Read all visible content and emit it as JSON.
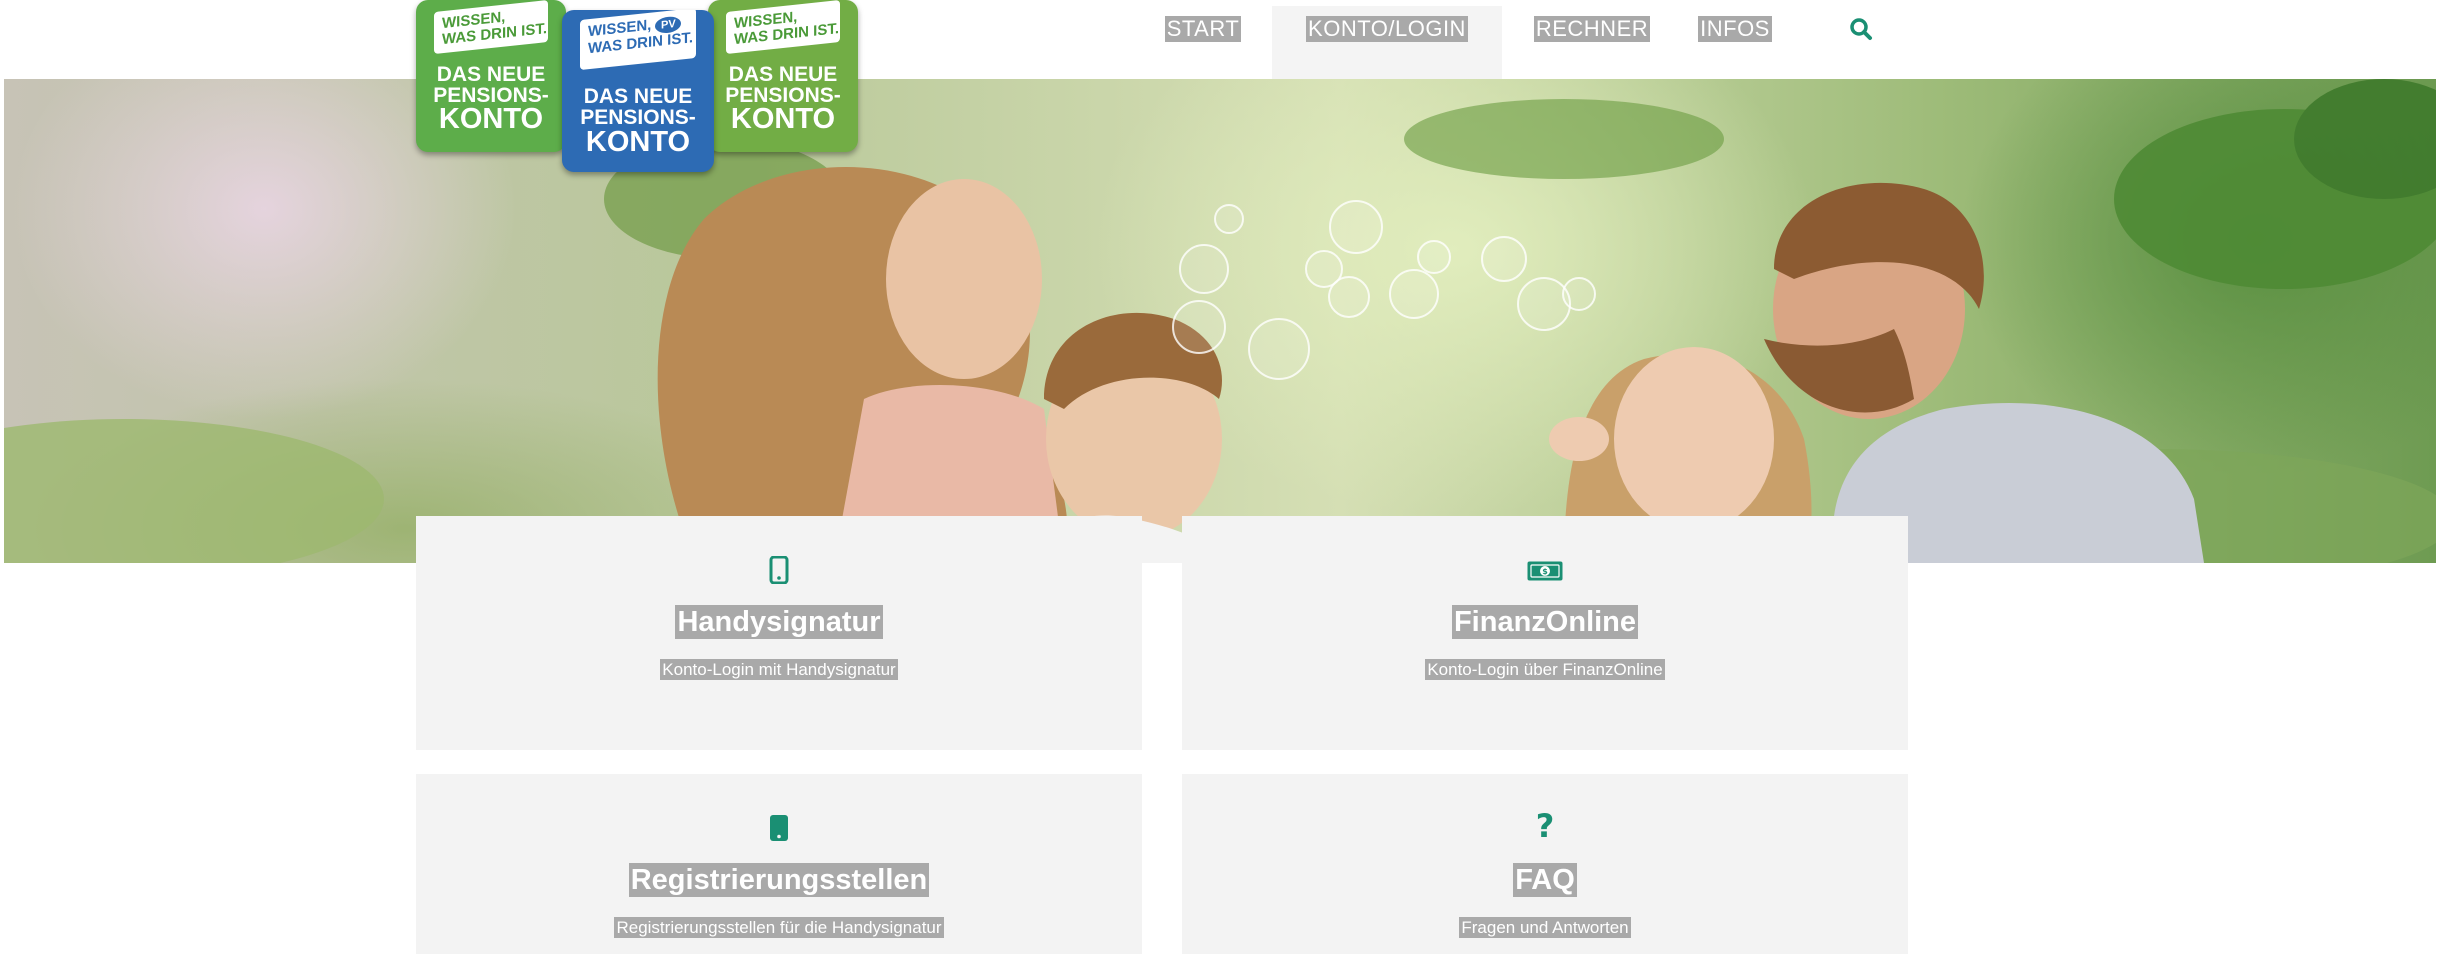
{
  "nav": {
    "items": [
      {
        "label": "START",
        "active": false
      },
      {
        "label": "KONTO/LOGIN",
        "active": true
      },
      {
        "label": "RECHNER",
        "active": false
      },
      {
        "label": "INFOS",
        "active": false
      }
    ],
    "search_icon": "search-icon"
  },
  "logo": {
    "slogan": "WISSEN, WAS DRIN IST.",
    "slogan_line1": "WISSEN,",
    "slogan_line2": "WAS DRIN IST.",
    "line1": "DAS NEUE",
    "line2": "PENSIONS-",
    "line3": "KONTO",
    "badge": "PV"
  },
  "cards": [
    {
      "icon": "mobile-phone-icon",
      "title": "Handysignatur",
      "description": "Konto-Login mit Handysignatur"
    },
    {
      "icon": "money-bill-icon",
      "title": "FinanzOnline",
      "description": "Konto-Login über FinanzOnline"
    },
    {
      "icon": "tablet-icon",
      "title": "Registrierungsstellen",
      "description": "Registrierungsstellen für die Handysignatur"
    },
    {
      "icon": "question-mark-icon",
      "title": "FAQ",
      "description": "Fragen und Antworten"
    }
  ],
  "colors": {
    "accent": "#1a8f73",
    "label_bg": "#a9a9a9",
    "card_bg": "#f3f3f3",
    "logo_green": "#5dad4a",
    "logo_blue": "#2d6bb4"
  }
}
